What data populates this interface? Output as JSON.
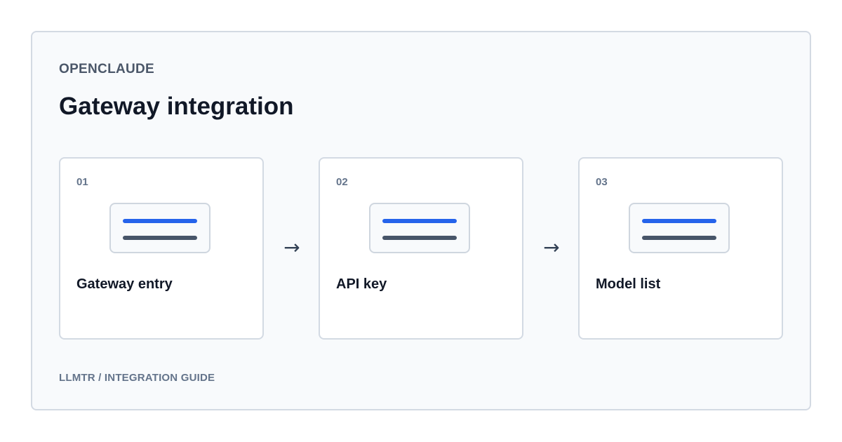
{
  "brand": "OPENCLAUDE",
  "title": "Gateway integration",
  "steps": [
    {
      "number": "01",
      "label": "Gateway entry"
    },
    {
      "number": "02",
      "label": "API key"
    },
    {
      "number": "03",
      "label": "Model list"
    }
  ],
  "arrow_glyph": "→",
  "footer": "LLMTR / INTEGRATION GUIDE",
  "colors": {
    "accent": "#2563eb",
    "secondary_line": "#475569",
    "heading": "#111827",
    "muted": "#64748b",
    "frame_background": "#f8fafc",
    "border": "#d3dae3"
  },
  "icons": [
    "document-lines-icon",
    "document-lines-icon",
    "document-lines-icon",
    "right-arrow-icon",
    "right-arrow-icon"
  ]
}
